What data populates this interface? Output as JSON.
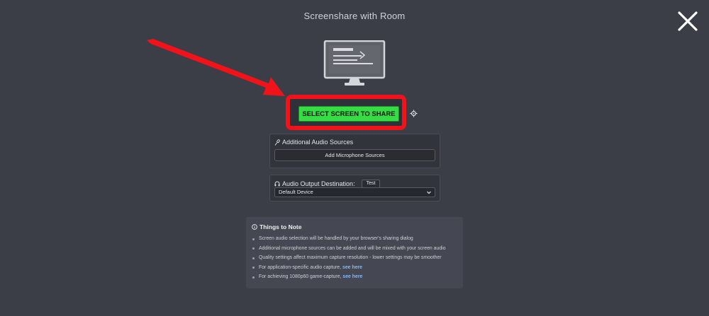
{
  "header": {
    "title": "Screenshare with Room"
  },
  "main": {
    "select_screen_label": "SELECT SCREEN TO SHARE"
  },
  "audio_sources": {
    "heading": "Additional Audio Sources",
    "add_mic_label": "Add Microphone Sources"
  },
  "audio_output": {
    "heading": "Audio Output Destination:",
    "test_label": "Test",
    "selected_device": "Default Device"
  },
  "notes": {
    "heading": "Things to Note",
    "items": [
      {
        "text": "Screen audio selection will be handled by your browser's sharing dialog",
        "link": ""
      },
      {
        "text": "Additional microphone sources can be added and will be mixed with your screen audio",
        "link": ""
      },
      {
        "text": "Quality settings affect maximum capture resolution - lower settings may be smoother",
        "link": ""
      },
      {
        "text": "For application-specific audio capture,",
        "link": "see here"
      },
      {
        "text": "For achieving 1080p60 game-capture,",
        "link": "see here"
      }
    ]
  },
  "icons": {
    "close": "close-icon",
    "monitor": "monitor-icon",
    "settings": "settings-icon",
    "microphone": "microphone-icon",
    "headphones": "headphones-icon",
    "info": "info-icon",
    "chevron": "chevron-down-icon"
  },
  "colors": {
    "background": "#3b3e47",
    "select_button": "#35dc43",
    "highlight": "#f2121a",
    "link": "#7fb8ff"
  }
}
